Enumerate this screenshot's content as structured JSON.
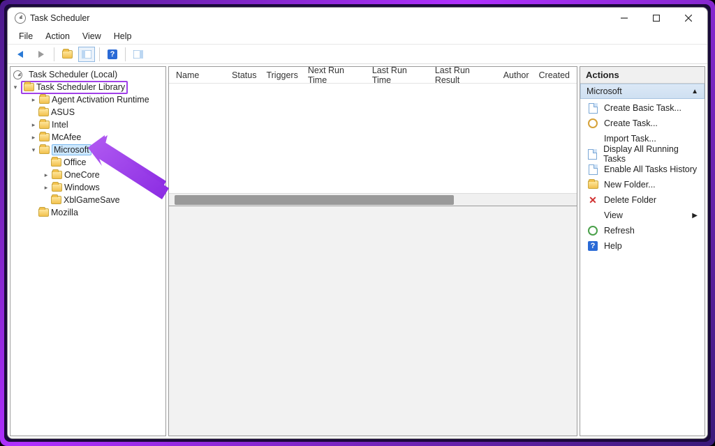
{
  "window": {
    "title": "Task Scheduler"
  },
  "menus": {
    "file": "File",
    "action": "Action",
    "view": "View",
    "help": "Help"
  },
  "tree": {
    "root": "Task Scheduler (Local)",
    "library": "Task Scheduler Library",
    "items": {
      "agent": "Agent Activation Runtime",
      "asus": "ASUS",
      "intel": "Intel",
      "mcafee": "McAfee",
      "microsoft": "Microsoft",
      "office": "Office",
      "onecore": "OneCore",
      "windows": "Windows",
      "xbl": "XblGameSave",
      "mozilla": "Mozilla"
    }
  },
  "columns": {
    "name": "Name",
    "status": "Status",
    "triggers": "Triggers",
    "nextrun": "Next Run Time",
    "lastrun": "Last Run Time",
    "lastresult": "Last Run Result",
    "author": "Author",
    "created": "Created"
  },
  "actions": {
    "header": "Actions",
    "context": "Microsoft",
    "items": {
      "createBasic": "Create Basic Task...",
      "createTask": "Create Task...",
      "importTask": "Import Task...",
      "displayAll": "Display All Running Tasks",
      "enableHistory": "Enable All Tasks History",
      "newFolder": "New Folder...",
      "deleteFolder": "Delete Folder",
      "view": "View",
      "refresh": "Refresh",
      "help": "Help"
    }
  }
}
